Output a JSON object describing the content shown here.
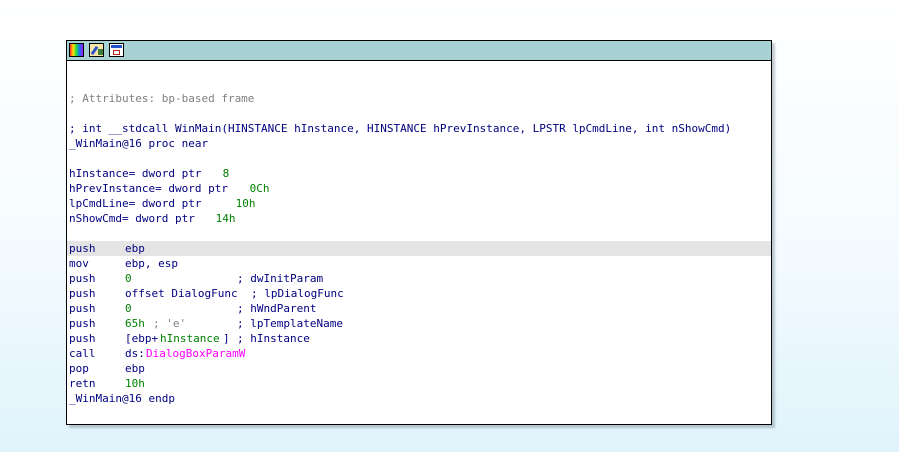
{
  "colors": {
    "title_bar": "#a8d1d3",
    "code_default": "#000080",
    "comment": "#808080",
    "number": "#008000",
    "import": "#ff00ff",
    "highlight": "#e4e4e4"
  },
  "toolbar": {
    "icons": [
      "color-palette-icon",
      "edit-node-icon",
      "graph-overview-icon"
    ]
  },
  "code": {
    "attributes_comment": "; Attributes: bp-based frame",
    "signature_comment": "; int __stdcall WinMain(HINSTANCE hInstance, HINSTANCE hPrevInstance, LPSTR lpCmdLine, int nShowCmd)",
    "proc_start": "_WinMain@16 proc near",
    "args": [
      {
        "label": "hInstance= dword ptr ",
        "value": " 8"
      },
      {
        "label": "hPrevInstance= dword ptr ",
        "value": " 0Ch"
      },
      {
        "label": "lpCmdLine= dword ptr ",
        "value": " 10h"
      },
      {
        "label": "nShowCmd= dword ptr ",
        "value": " 14h"
      }
    ],
    "instructions": [
      {
        "mnem": "push",
        "op": "ebp",
        "cmt": ""
      },
      {
        "mnem": "mov",
        "op": "ebp, esp",
        "cmt": ""
      },
      {
        "mnem": "push",
        "op": "0",
        "cmt": "; dwInitParam"
      },
      {
        "mnem": "push",
        "op": "offset DialogFunc",
        "cmt": "; lpDialogFunc"
      },
      {
        "mnem": "push",
        "op": "0",
        "cmt": "; hWndParent"
      },
      {
        "mnem": "push",
        "op": "65h",
        "op_cmt": "; 'e'",
        "cmt": "; lpTemplateName"
      },
      {
        "mnem": "push",
        "op_a": "[ebp+",
        "op_b": "hInstance",
        "op_c": "]",
        "cmt": "; hInstance"
      },
      {
        "mnem": "call",
        "op_a": "ds:",
        "op_b": "DialogBoxParamW"
      },
      {
        "mnem": "pop",
        "op": "ebp",
        "cmt": ""
      },
      {
        "mnem": "retn",
        "op": "10h",
        "cmt": ""
      }
    ],
    "proc_end": "_WinMain@16 endp"
  }
}
